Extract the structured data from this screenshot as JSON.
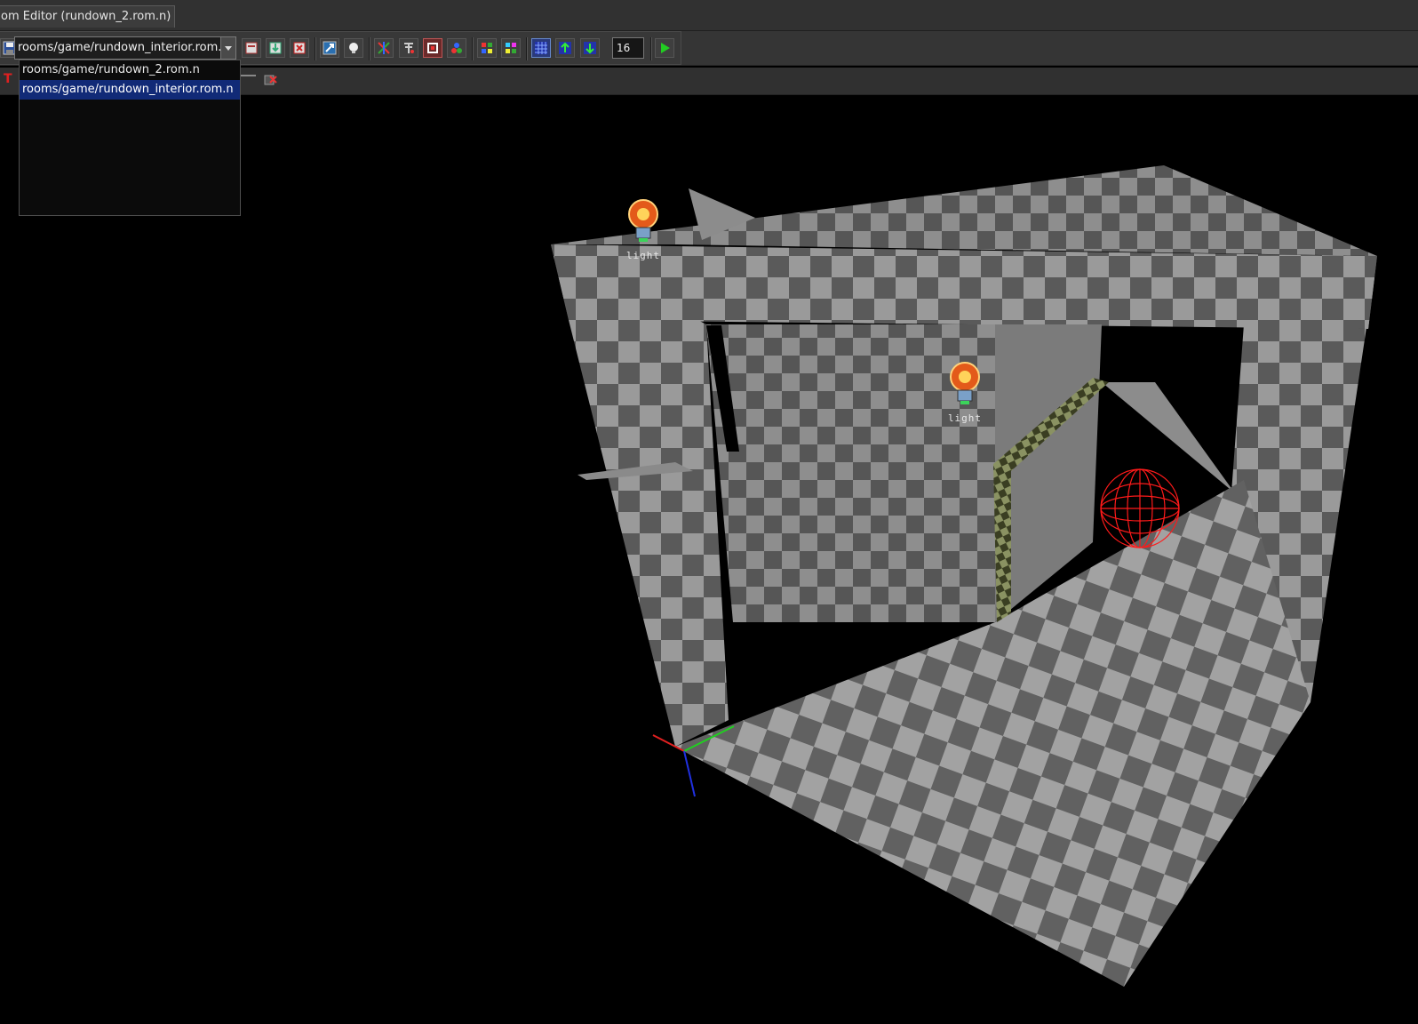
{
  "window": {
    "tab_title": "om Editor (rundown_2.rom.n)"
  },
  "toolbar": {
    "room_select": {
      "value": "rooms/game/rundown_interior.rom.n"
    },
    "grid_size": "16"
  },
  "dropdown": {
    "options": [
      {
        "label": "rooms/game/rundown_2.rom.n",
        "selected": false
      },
      {
        "label": "rooms/game/rundown_interior.rom.n",
        "selected": true
      }
    ]
  },
  "viewport": {
    "lights": [
      {
        "label": "light"
      },
      {
        "label": "light"
      }
    ]
  },
  "colors": {
    "checker_light": "#9a9a9a",
    "checker_dark": "#5a5a5a",
    "selection": "#112a77",
    "sphere": "#ff1a1a"
  }
}
